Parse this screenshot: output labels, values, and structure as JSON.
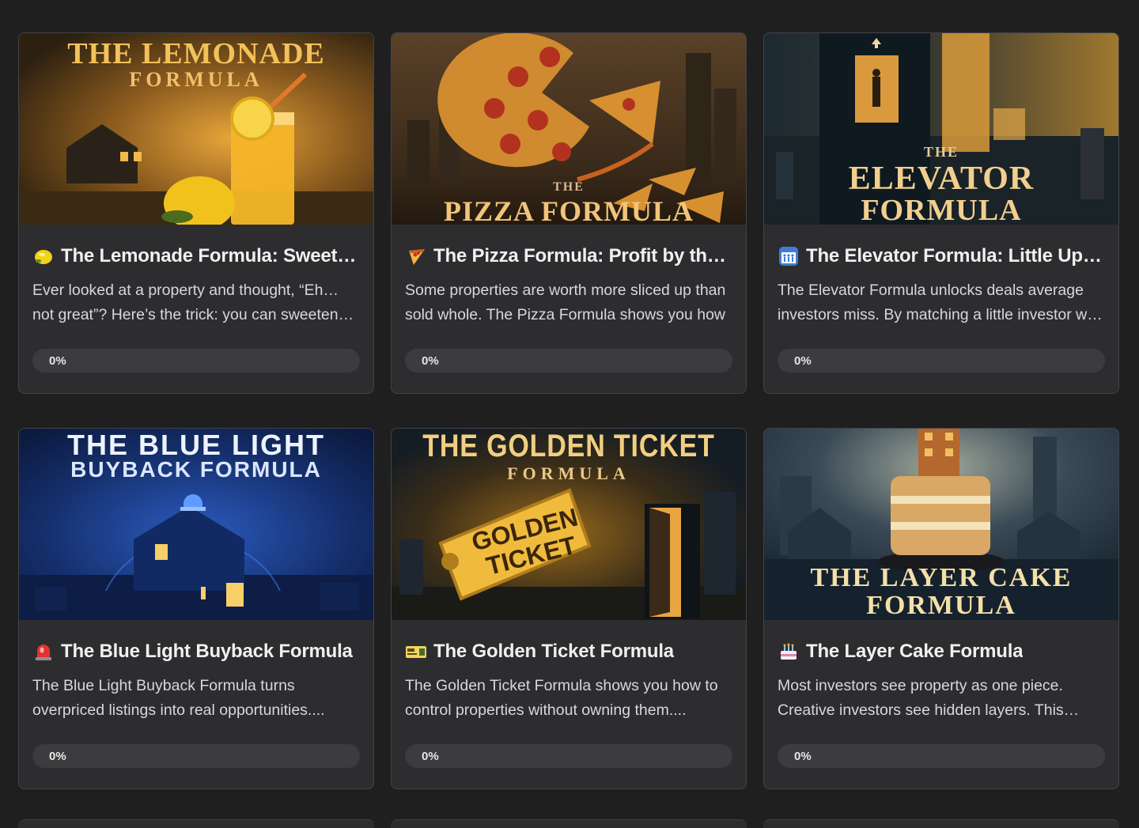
{
  "courses": [
    {
      "image_title_top": "THE LEMONADE",
      "image_title_bottom": "FORMULA",
      "emoji_icon": "lemon-icon",
      "title": "The Lemonade Formula: Sweeten the Deal",
      "description": "Ever looked at a property and thought, “Eh… not great”? Here’s the trick: you can sweeten the deal",
      "progress_label": "0%",
      "progress": 0
    },
    {
      "image_title_top": "THE",
      "image_title_bottom": "PIZZA FORMULA",
      "emoji_icon": "pizza-icon",
      "title": "The Pizza Formula: Profit by the Slice",
      "description": "Some properties are worth more sliced up than sold whole. The Pizza Formula shows you how",
      "progress_label": "0%",
      "progress": 0
    },
    {
      "image_title_top": "THE",
      "image_title_middle": "ELEVATOR",
      "image_title_bottom": "FORMULA",
      "emoji_icon": "elevator-icon",
      "title": "The Elevator Formula: Little Up, Big Up",
      "description": "The Elevator Formula unlocks deals average investors miss. By matching a little investor with a big one",
      "progress_label": "0%",
      "progress": 0
    },
    {
      "image_title_top": "THE BLUE LIGHT",
      "image_title_bottom": "BUYBACK FORMULA",
      "emoji_icon": "siren-icon",
      "title": "The Blue Light Buyback Formula",
      "description": "The Blue Light Buyback Formula turns overpriced listings into real opportunities....",
      "progress_label": "0%",
      "progress": 0
    },
    {
      "image_title_top": "THE GOLDEN TICKET",
      "image_title_bottom": "FORMULA",
      "ticket_text_1": "GOLDEN",
      "ticket_text_2": "TICKET",
      "emoji_icon": "ticket-icon",
      "title": "The Golden Ticket Formula",
      "description": "The Golden Ticket Formula shows you how to control properties without owning them....",
      "progress_label": "0%",
      "progress": 0
    },
    {
      "image_title_top": "THE LAYER CAKE",
      "image_title_bottom": "FORMULA",
      "emoji_icon": "cake-icon",
      "title": "The Layer Cake Formula",
      "description": "Most investors see property as one piece. Creative investors see hidden layers. This formula shows you how",
      "progress_label": "0%",
      "progress": 0
    }
  ]
}
